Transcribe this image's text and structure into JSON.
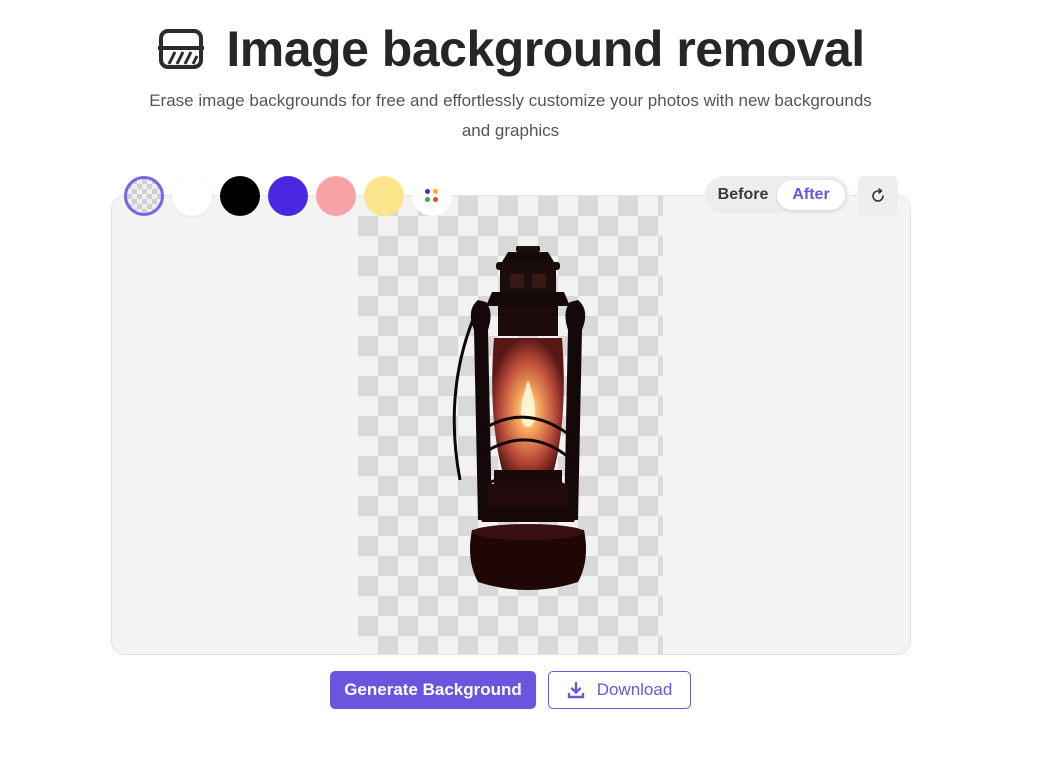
{
  "header": {
    "title": "Image background removal",
    "subtitle_line1": "Erase image backgrounds for free and effortlessly customize your photos with new backgrounds",
    "subtitle_line2": "and graphics"
  },
  "swatches": [
    {
      "name": "transparent",
      "color": "transparent",
      "selected": true
    },
    {
      "name": "white",
      "color": "#ffffff"
    },
    {
      "name": "black",
      "color": "#000000"
    },
    {
      "name": "blue",
      "color": "#4a27e0"
    },
    {
      "name": "pink",
      "color": "#f8a3a7"
    },
    {
      "name": "yellow",
      "color": "#fce68c"
    },
    {
      "name": "more-colors",
      "color": "multicolor"
    }
  ],
  "view_toggle": {
    "before_label": "Before",
    "after_label": "After",
    "active": "After"
  },
  "actions": {
    "generate_label": "Generate Background",
    "download_label": "Download"
  },
  "colors": {
    "accent": "#6c54de",
    "canvas_bg": "#f4f4f4"
  },
  "icons": {
    "logo": "eraser-icon",
    "reset": "rotate-icon",
    "download": "download-icon"
  }
}
